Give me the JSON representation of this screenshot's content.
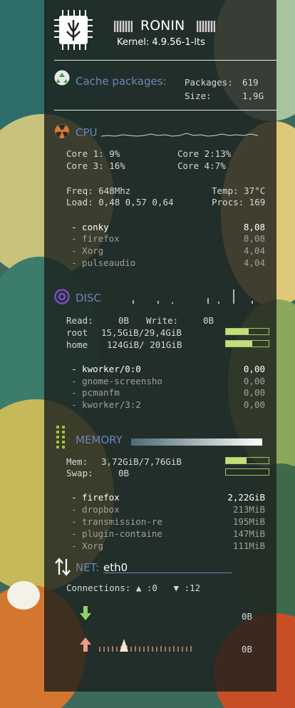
{
  "header": {
    "hostname": "RONIN",
    "kernel": "Kernel: 4.9.56-1-lts"
  },
  "cache": {
    "title": "Cache packages:",
    "packages_label": "Packages:",
    "packages_value": "619",
    "size_label": "Size:",
    "size_value": "1,9G"
  },
  "cpu": {
    "title": "CPU",
    "cores": [
      "Core 1: 9%",
      "Core 2:13%",
      "Core 3: 16%",
      "Core 4:7%"
    ],
    "freq": "Freq: 648Mhz",
    "temp": "Temp: 37°C",
    "load": "Load: 0,48 0,57 0,64",
    "procs": "Procs: 169",
    "processes": [
      {
        "name": "- conky",
        "value": "8,08"
      },
      {
        "name": "- firefox",
        "value": "8,08"
      },
      {
        "name": "- Xorg",
        "value": "4,04"
      },
      {
        "name": "- pulseaudio",
        "value": "4,04"
      }
    ]
  },
  "disc": {
    "title": "DISC",
    "read_label": "Read:",
    "read_value": "0B",
    "write_label": "Write:",
    "write_value": "0B",
    "fs": [
      {
        "mount": "root",
        "usage": "15,5GiB/29,4GiB",
        "fill": 0.53
      },
      {
        "mount": "home",
        "usage": "124GiB/ 201GiB",
        "fill": 0.62
      }
    ],
    "processes": [
      {
        "name": "- kworker/0:0",
        "value": "0,00"
      },
      {
        "name": "- gnome-screensho",
        "value": "0,00"
      },
      {
        "name": "- pcmanfm",
        "value": "0,00"
      },
      {
        "name": "- kworker/3:2",
        "value": "0,00"
      }
    ]
  },
  "memory": {
    "title": "MEMORY",
    "mem_label": "Mem:",
    "mem_value": "3,72GiB/7,76GiB",
    "mem_fill": 0.48,
    "swap_label": "Swap:",
    "swap_value": "0B",
    "swap_fill": 0,
    "processes": [
      {
        "name": "- firefox",
        "value": "2,22GiB"
      },
      {
        "name": "- dropbox",
        "value": "213MiB"
      },
      {
        "name": "- transmission-re",
        "value": "195MiB"
      },
      {
        "name": "- plugin-containe",
        "value": "147MiB"
      },
      {
        "name": "- Xorg",
        "value": "111MiB"
      }
    ]
  },
  "net": {
    "title": "NET:",
    "interface": "eth0",
    "connections": "Connections: ▲ :0   ▼ :12",
    "down_value": "0B",
    "up_value": "0B"
  },
  "icons": {
    "chip": "chip-logo-icon",
    "recycle": "recycle-icon",
    "radiation": "radiation-icon",
    "disc": "disc-icon",
    "memory": "memory-dots-icon",
    "updown": "up-down-arrows-icon",
    "down": "down-arrow-icon",
    "up": "up-arrow-icon"
  },
  "colors": {
    "accent": "#6b86b6",
    "bar": "#c2df7c",
    "cpu_icon": "#d47a2e",
    "disc_icon": "#7c4bc7",
    "recycle": "#3aa24a",
    "down_arrow": "#8fd36a",
    "up_arrow": "#f19a8c"
  }
}
